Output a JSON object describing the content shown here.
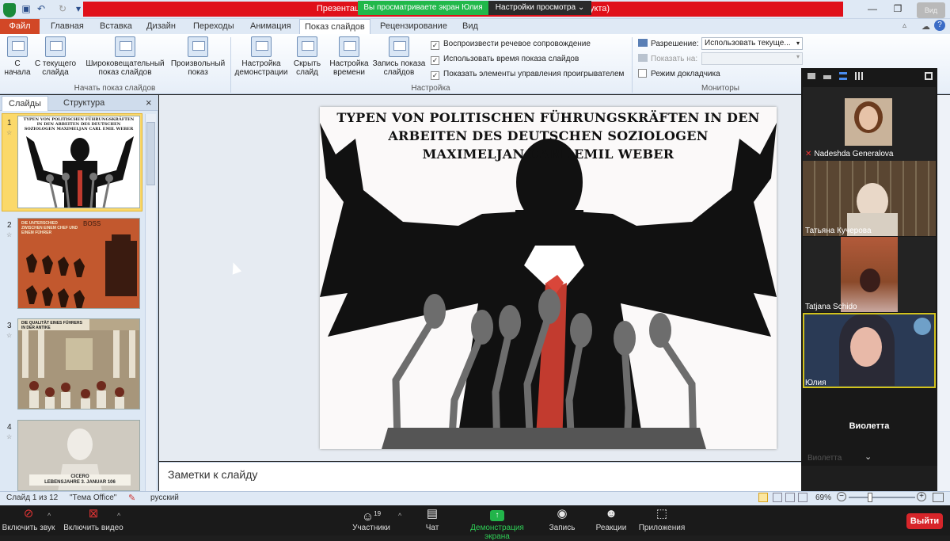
{
  "window": {
    "title": "Презентация в формате Microsoft PowerPoint (сбой активации продукта)",
    "share_banner": "Вы просматриваете экран Юлия",
    "view_options": "Настройки просмотра ⌄",
    "view_button": "Вид"
  },
  "ribbon": {
    "file_tab": "Файл",
    "tabs": [
      "Главная",
      "Вставка",
      "Дизайн",
      "Переходы",
      "Анимация",
      "Показ слайдов",
      "Рецензирование",
      "Вид"
    ],
    "buttons": {
      "from_start": "С начала",
      "from_current": "С текущего слайда",
      "broadcast": "Широковещательный показ слайдов",
      "custom": "Произвольный показ",
      "setup": "Настройка демонстрации",
      "hide": "Скрыть слайд",
      "rehearse": "Настройка времени",
      "record": "Запись показа слайдов"
    },
    "checkboxes": [
      {
        "label": "Воспроизвести речевое сопровождение",
        "checked": true
      },
      {
        "label": "Использовать время показа слайдов",
        "checked": true
      },
      {
        "label": "Показать элементы управления проигрывателем",
        "checked": true
      }
    ],
    "monitors": {
      "resolution_label": "Разрешение:",
      "resolution_value": "Использовать текуще...",
      "show_on_label": "Показать на:",
      "presenter_view": "Режим докладчика"
    },
    "groups": [
      "Начать показ слайдов",
      "Настройка",
      "Мониторы"
    ]
  },
  "slides_panel": {
    "tab_slides": "Слайды",
    "tab_outline": "Структура",
    "close": "×",
    "thumbs": [
      {
        "num": "1",
        "caption": "Typen von politischen Führungskräften in den Arbeiten des deutschen Soziologen Maximeljan Carl Emil Weber"
      },
      {
        "num": "2",
        "caption": "Die Unterschied zwischen einem Chef und einem Führer",
        "boss": "BOSS"
      },
      {
        "num": "3",
        "caption": "Die Qualität eines Führers in der Antike"
      },
      {
        "num": "4",
        "caption": "CICERO",
        "sub": "Lebensjahre 3. Januar 106"
      }
    ]
  },
  "slide": {
    "title_line1": "Typen von politischen Führungskräften in den",
    "title_line2": "Arbeiten des deutschen Soziologen",
    "title_line3": "Maximeljan Carl Emil Weber"
  },
  "notes_placeholder": "Заметки к слайду",
  "status": {
    "slide_of": "Слайд 1 из 12",
    "theme": "\"Тема Office\"",
    "language": "русский",
    "zoom": "69%"
  },
  "participants": [
    {
      "name": "Nadeshda Generalova",
      "muted": true
    },
    {
      "name": "Татьяна Кучерова"
    },
    {
      "name": "Tatjana Schido"
    },
    {
      "name": "Юлия"
    },
    {
      "name": "Виолетта"
    }
  ],
  "participants_footer": "Виолетта",
  "zoom_toolbar": {
    "unmute": "Включить звук",
    "video": "Включить видео",
    "participants": "Участники",
    "participants_count": "19",
    "chat": "Чат",
    "share": "Демонстрация экрана",
    "record": "Запись",
    "reactions": "Реакции",
    "apps": "Приложения",
    "leave": "Выйти"
  }
}
